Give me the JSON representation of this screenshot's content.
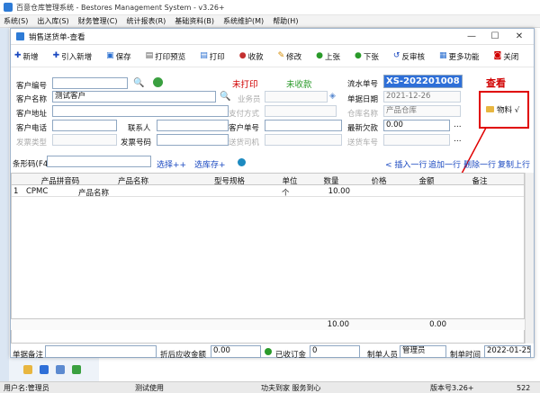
{
  "app": {
    "title": "百意仓库管理系统 - Bestores Management System - v3.26+",
    "menu": [
      "系统(S)",
      "出入库(S)",
      "财务管理(C)",
      "统计报表(R)",
      "基础资料(B)",
      "系统维护(M)",
      "帮助(H)"
    ]
  },
  "dialog": {
    "title": "销售送货单-查看",
    "controls": {
      "minimize": "—",
      "maximize": "☐",
      "close": "✕"
    },
    "toolbar": [
      {
        "icon": "plus-icon",
        "label": "新增",
        "color": "#1a48c0"
      },
      {
        "icon": "import-icon",
        "label": "引入新增",
        "color": "#1a48c0"
      },
      {
        "icon": "save-icon",
        "label": "保存",
        "color": "#2a6fd0"
      },
      {
        "icon": "print-preview-icon",
        "label": "打印预览",
        "color": "#555555"
      },
      {
        "icon": "print-icon",
        "label": "打印",
        "color": "#2a6fd0"
      },
      {
        "icon": "cash-icon",
        "label": "收款",
        "color": "#c43030"
      },
      {
        "icon": "edit-icon",
        "label": "修改",
        "color": "#d48b00"
      },
      {
        "icon": "up-icon",
        "label": "上张",
        "color": "#2a9a2a"
      },
      {
        "icon": "down-icon",
        "label": "下张",
        "color": "#2a9a2a"
      },
      {
        "icon": "unaudit-icon",
        "label": "反审核",
        "color": "#1a48c0"
      },
      {
        "icon": "more-icon",
        "label": "更多功能",
        "color": "#2a6fd0"
      },
      {
        "icon": "close-icon",
        "label": "关闭",
        "color": "#d00000"
      }
    ],
    "form": {
      "customer_code_label": "客户编号",
      "customer_code": "",
      "customer_name_label": "客户名称",
      "customer_name": "测试客户",
      "customer_addr_label": "客户地址",
      "customer_addr": "",
      "customer_phone_label": "客户电话",
      "customer_phone": "",
      "contact_label": "联系人",
      "contact": "",
      "invoice_type_label": "发票类型",
      "invoice_type": "",
      "invoice_no_label": "发票号码",
      "invoice_no": "",
      "print_status": "未打印",
      "pay_status": "未收款",
      "salesman_label": "业务员",
      "salesman": "",
      "pay_method_label": "支付方式",
      "pay_method": "",
      "customer_order_label": "客户单号",
      "customer_order": "",
      "driver_label": "送货司机",
      "driver": "",
      "serial_label": "流水单号",
      "serial": "XS-202201008",
      "doc_date_label": "单据日期",
      "doc_date": "2021-12-26",
      "warehouse_label": "仓库名称",
      "warehouse": "产品仓库",
      "arrears_label": "最新欠款",
      "arrears": "0.00",
      "car_label": "送货车号",
      "car": "",
      "annotation": "查看",
      "material_label": "物料 √",
      "ellipsis": "..."
    },
    "barcode": {
      "label": "条形码(F4)",
      "value": "",
      "choose_plus": "选择++",
      "choose_stock": "选库存+",
      "insert_row": "< 插入一行",
      "append_row": "追加一行",
      "delete_row": "删除一行",
      "copy_row": "复制上行"
    },
    "table": {
      "columns": [
        "产品拼音码",
        "产品名称",
        "型号规格",
        "单位",
        "数量",
        "价格",
        "金额",
        "备注"
      ],
      "rows": [
        {
          "idx": "1",
          "pinyin": "CPMC",
          "name": "产品名称",
          "spec": "",
          "unit": "个",
          "qty": "10.00",
          "price": "",
          "amount": "",
          "note": ""
        }
      ],
      "total_qty": "10.00",
      "total_amount": "0.00"
    },
    "footer": {
      "remark_label": "单据备注",
      "remark": "",
      "receivable_label": "折后应收金额",
      "receivable": "0.00",
      "received_label": "已收订金",
      "received": "0",
      "maker_label": "制单人员",
      "maker": "管理员",
      "make_time_label": "制单时间",
      "make_time": "2022-01-25"
    }
  },
  "status": {
    "user": "用户名:管理员",
    "unit": "测试使用",
    "slogan": "功夫到家 服务到心",
    "version": "版本号3.26+",
    "code": "522"
  },
  "colors": {
    "accent": "#1a48c0",
    "highlight": "#2e6fd8",
    "annotation": "#d00000"
  }
}
